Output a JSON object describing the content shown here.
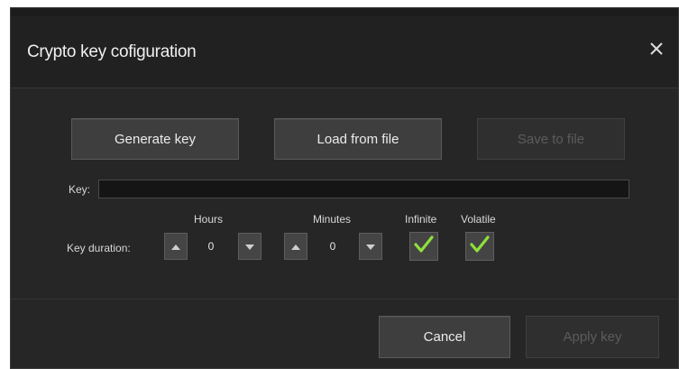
{
  "dialog": {
    "title": "Crypto key cofiguration",
    "close_icon": "close-icon"
  },
  "actions": {
    "generate_key": "Generate key",
    "load_from_file": "Load from file",
    "save_to_file": "Save to file"
  },
  "key": {
    "label": "Key:",
    "value": ""
  },
  "duration": {
    "label": "Key duration:",
    "hours_label": "Hours",
    "hours_value": "0",
    "minutes_label": "Minutes",
    "minutes_value": "0",
    "infinite_label": "Infinite",
    "infinite_checked": true,
    "volatile_label": "Volatile",
    "volatile_checked": true
  },
  "footer": {
    "cancel": "Cancel",
    "apply_key": "Apply key"
  },
  "colors": {
    "check_green": "#8ee03a",
    "dialog_bg": "#262626"
  }
}
